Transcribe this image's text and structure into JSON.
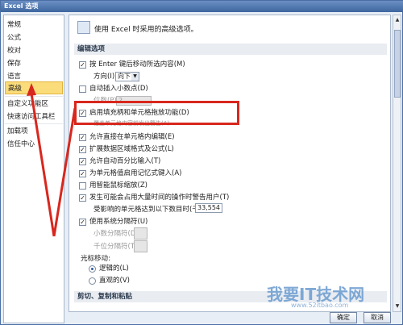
{
  "window": {
    "title": "Excel 选项"
  },
  "sidebar": {
    "items": [
      {
        "label": "常规"
      },
      {
        "label": "公式"
      },
      {
        "label": "校对"
      },
      {
        "label": "保存"
      },
      {
        "label": "语言"
      },
      {
        "label": "高级"
      },
      {
        "label": "自定义功能区"
      },
      {
        "label": "快速访问工具栏"
      },
      {
        "label": "加载项"
      },
      {
        "label": "信任中心"
      }
    ],
    "selected": "高级"
  },
  "main": {
    "header": "使用 Excel 时采用的高级选项。",
    "section_editing": "编辑选项",
    "enter_move": {
      "label": "按 Enter 键后移动所选内容(M)",
      "checked": true
    },
    "direction": {
      "label": "方向(I):",
      "value": "向下"
    },
    "auto_decimal": {
      "label": "自动插入小数点(D)",
      "checked": false
    },
    "places": {
      "label": "位数(P):",
      "value": "2"
    },
    "fill_handle": {
      "label": "启用填充柄和单元格拖放功能(D)",
      "checked": true
    },
    "overwrite_hint": "覆盖单元格内容前发出警告(A)",
    "edit_direct": {
      "label": "允许直接在单元格内编辑(E)",
      "checked": true
    },
    "extend_formats": {
      "label": "扩展数据区域格式及公式(L)",
      "checked": true
    },
    "auto_percent": {
      "label": "允许自动百分比输入(T)",
      "checked": true
    },
    "autocomplete": {
      "label": "为单元格值启用记忆式键入(A)",
      "checked": true
    },
    "intellimouse": {
      "label": "用智能鼠标缩放(Z)",
      "checked": false
    },
    "alert_slow": {
      "label": "发生可能会占用大量时间的操作时警告用户(T)",
      "checked": true
    },
    "cells_threshold": {
      "label": "受影响的单元格达到以下数目时(千)(U):",
      "value": "33,554"
    },
    "system_separators": {
      "label": "使用系统分隔符(U)",
      "checked": true
    },
    "decimal_sep": {
      "label": "小数分隔符(D):"
    },
    "thousands_sep": {
      "label": "千位分隔符(T):"
    },
    "cursor_move": {
      "label": "光标移动:"
    },
    "radio_logical": {
      "label": "逻辑的(L)",
      "selected": true
    },
    "radio_visual": {
      "label": "直观的(V)",
      "selected": false
    },
    "section_cut": "剪切、复制和粘贴"
  },
  "footer": {
    "ok": "确定",
    "cancel": "取消"
  },
  "watermark": {
    "text": "我要IT技术网",
    "sub": "www.52itbao.com"
  }
}
